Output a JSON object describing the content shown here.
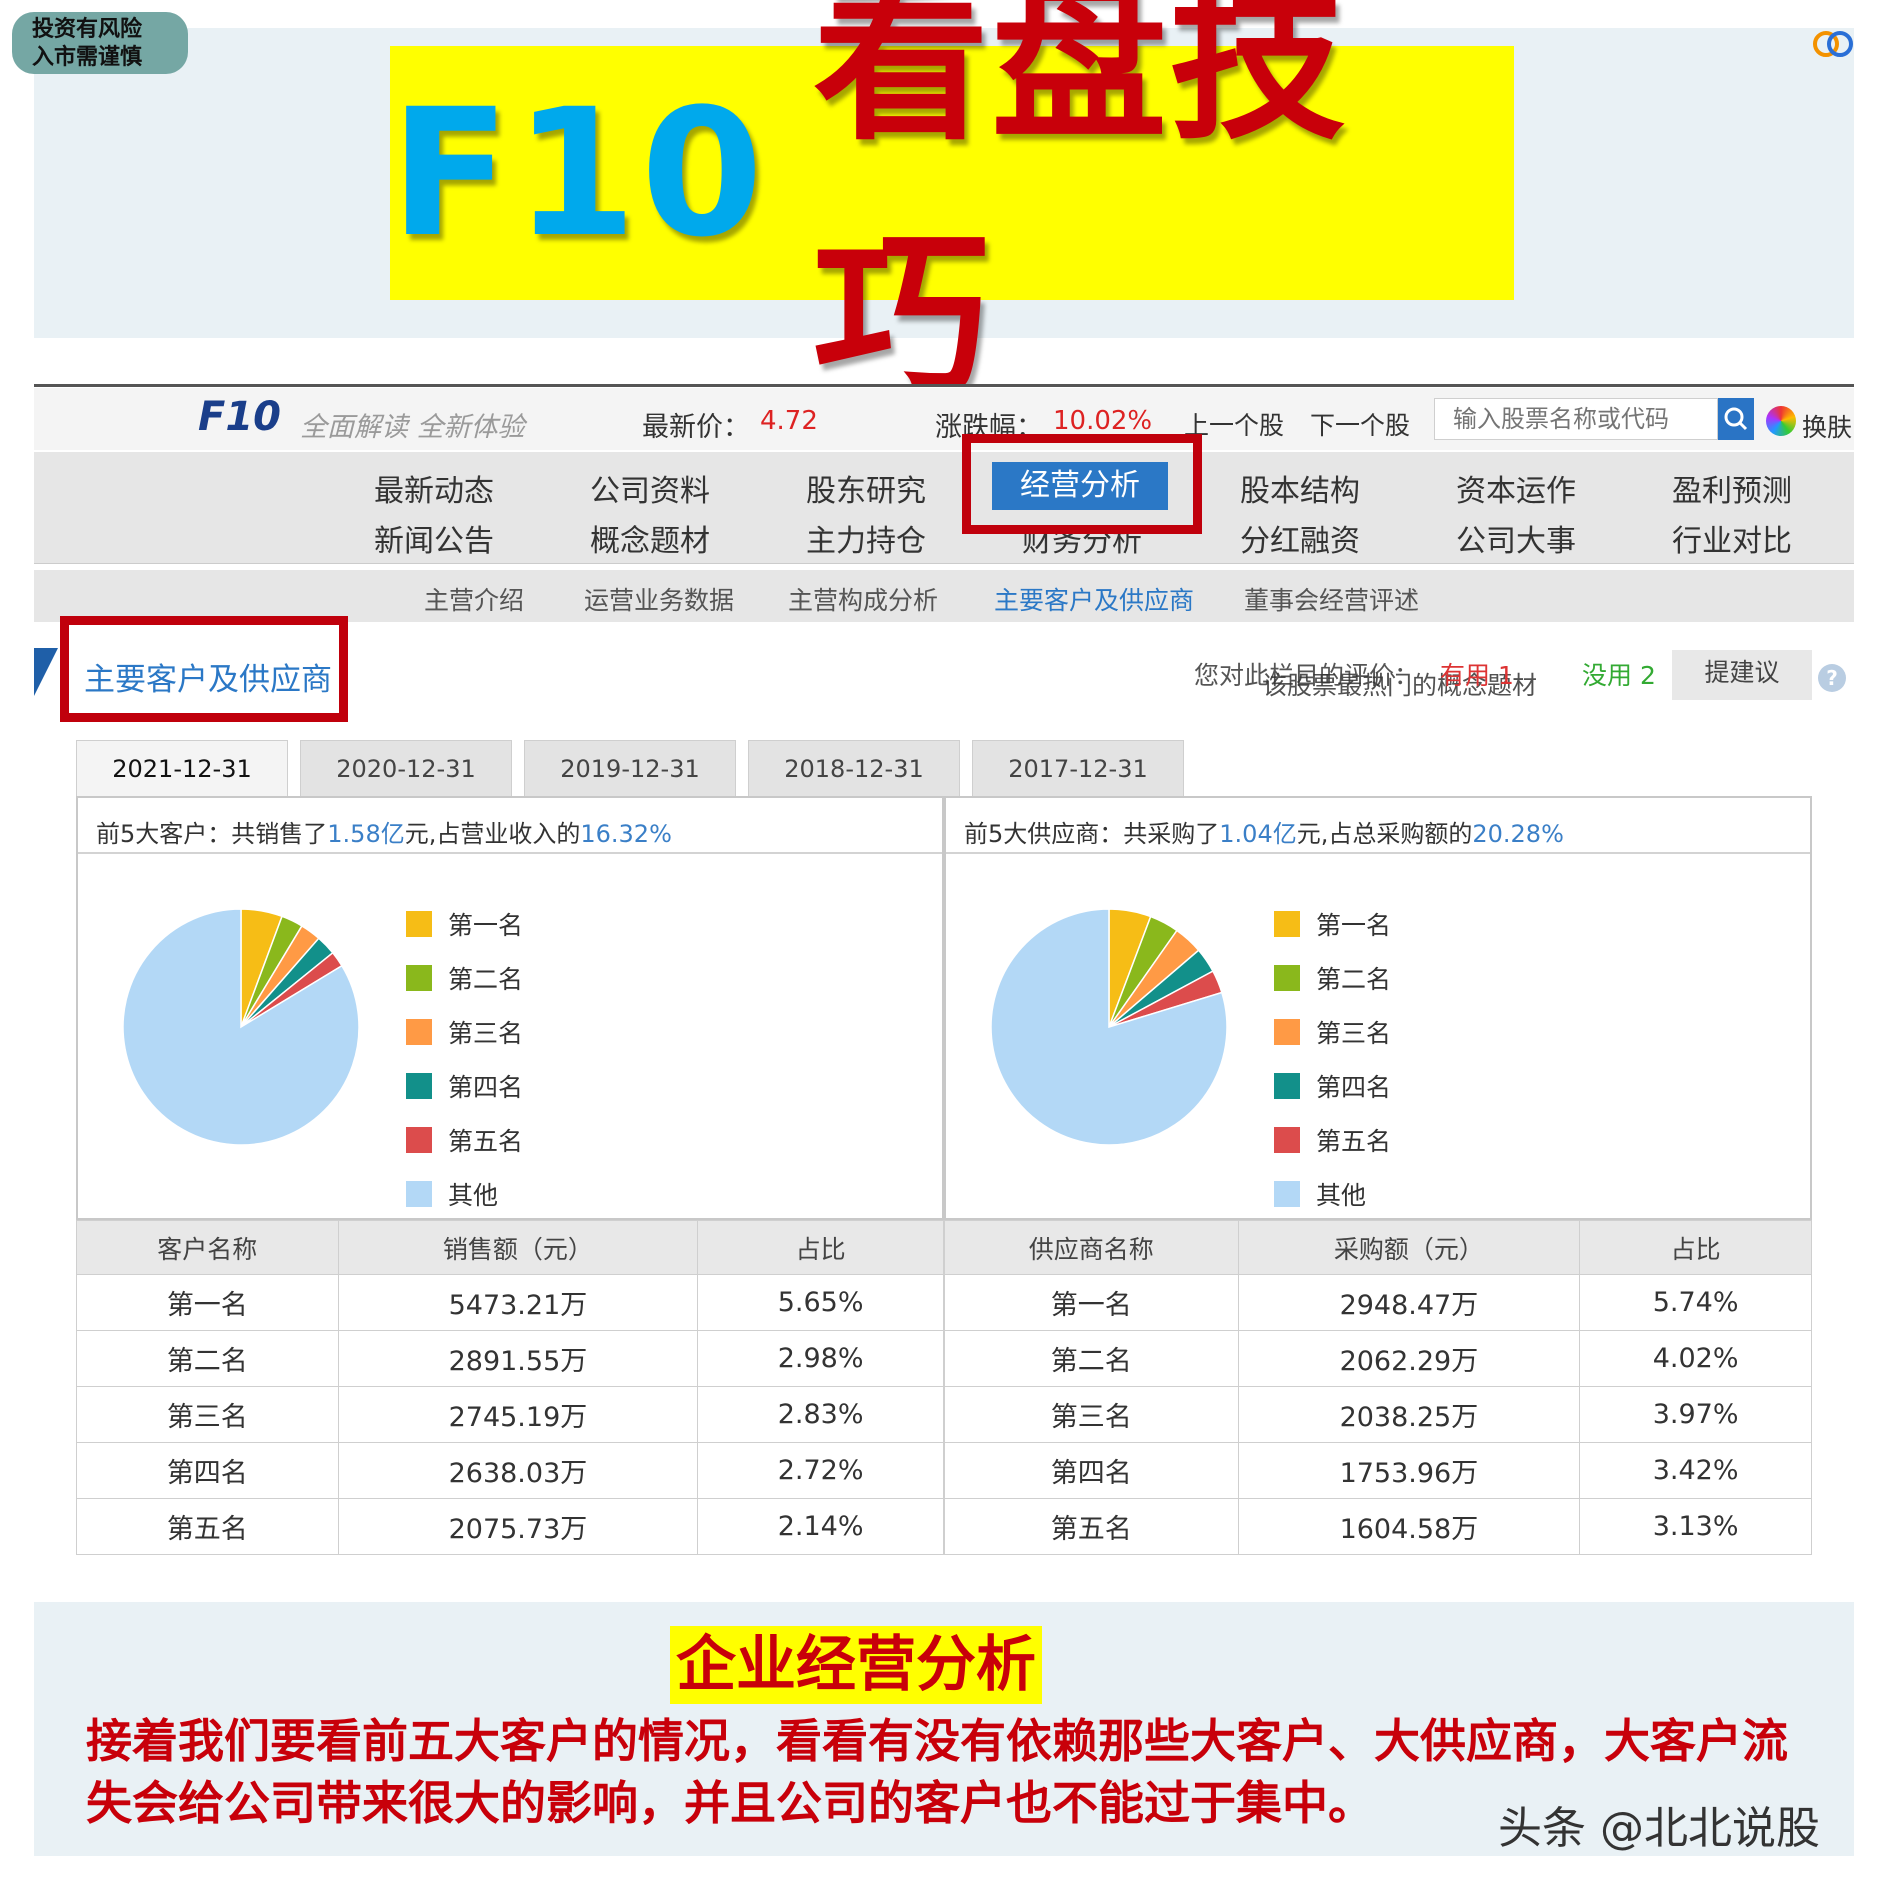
{
  "badge": {
    "line1": "投资有风险",
    "line2": "入市需谨慎"
  },
  "banner": {
    "title_prefix": "F10",
    "title_main": "看盘技巧"
  },
  "topbar": {
    "logo": "F10",
    "slogan": "全面解读 全新体验",
    "price_label": "最新价：",
    "price_value": "4.72",
    "change_label": "涨跌幅：",
    "change_value": "10.02%",
    "prev_stock": "上一个股",
    "next_stock": "下一个股",
    "search_placeholder": "输入股票名称或代码",
    "skin": "换肤"
  },
  "nav": {
    "row1": [
      "最新动态",
      "公司资料",
      "股东研究",
      "经营分析",
      "股本结构",
      "资本运作",
      "盈利预测"
    ],
    "row2": [
      "新闻公告",
      "概念题材",
      "主力持仓",
      "财务分析",
      "分红融资",
      "公司大事",
      "行业对比"
    ]
  },
  "subnav": [
    "主营介绍",
    "运营业务数据",
    "主营构成分析",
    "主要客户及供应商",
    "董事会经营评述"
  ],
  "section": {
    "title": "主要客户及供应商",
    "rate_prompt": "您对此栏目的评价：",
    "rate_overlay": "该股票最热门的概念题材",
    "useful": "有用 1",
    "useless": "没用 2",
    "suggest": "提建议",
    "help": "?"
  },
  "tabs": [
    "2021-12-31",
    "2020-12-31",
    "2019-12-31",
    "2018-12-31",
    "2017-12-31"
  ],
  "customers": {
    "head_pre": "前5大客户：共销售了",
    "amount": "1.58亿",
    "head_mid": "元,占营业收入的",
    "pct": "16.32%",
    "col_name": "客户名称",
    "col_amount": "销售额（元）",
    "col_ratio": "占比",
    "rows": [
      {
        "name": "第一名",
        "amount": "5473.21万",
        "ratio": "5.65%"
      },
      {
        "name": "第二名",
        "amount": "2891.55万",
        "ratio": "2.98%"
      },
      {
        "name": "第三名",
        "amount": "2745.19万",
        "ratio": "2.83%"
      },
      {
        "name": "第四名",
        "amount": "2638.03万",
        "ratio": "2.72%"
      },
      {
        "name": "第五名",
        "amount": "2075.73万",
        "ratio": "2.14%"
      }
    ]
  },
  "suppliers": {
    "head_pre": "前5大供应商：共采购了",
    "amount": "1.04亿",
    "head_mid": "元,占总采购额的",
    "pct": "20.28%",
    "col_name": "供应商名称",
    "col_amount": "采购额（元）",
    "col_ratio": "占比",
    "rows": [
      {
        "name": "第一名",
        "amount": "2948.47万",
        "ratio": "5.74%"
      },
      {
        "name": "第二名",
        "amount": "2062.29万",
        "ratio": "4.02%"
      },
      {
        "name": "第三名",
        "amount": "2038.25万",
        "ratio": "3.97%"
      },
      {
        "name": "第四名",
        "amount": "1753.96万",
        "ratio": "3.42%"
      },
      {
        "name": "第五名",
        "amount": "1604.58万",
        "ratio": "3.13%"
      }
    ]
  },
  "legend": [
    "第一名",
    "第二名",
    "第三名",
    "第四名",
    "第五名",
    "其他"
  ],
  "colors": {
    "slices": [
      "#f6bd16",
      "#8ab81c",
      "#ff9a45",
      "#12908a",
      "#dc4c4c",
      "#b3d8f6"
    ],
    "accent_blue": "#2b78c6",
    "highlight_red": "#c0000c",
    "banner_yellow": "#ffff00"
  },
  "chart_data": [
    {
      "type": "pie",
      "categories": [
        "第一名",
        "第二名",
        "第三名",
        "第四名",
        "第五名",
        "其他"
      ],
      "values": [
        5.65,
        2.98,
        2.83,
        2.72,
        2.14,
        83.68
      ]
    },
    {
      "type": "pie",
      "categories": [
        "第一名",
        "第二名",
        "第三名",
        "第四名",
        "第五名",
        "其他"
      ],
      "values": [
        5.74,
        4.02,
        3.97,
        3.42,
        3.13,
        79.72
      ]
    }
  ],
  "caption": {
    "title": "企业经营分析",
    "body": "接着我们要看前五大客户的情况，看看有没有依赖那些大客户、大供应商，大客户流失会给公司带来很大的影响，并且公司的客户也不能过于集中。"
  },
  "watermark": "头条 @北北说股"
}
